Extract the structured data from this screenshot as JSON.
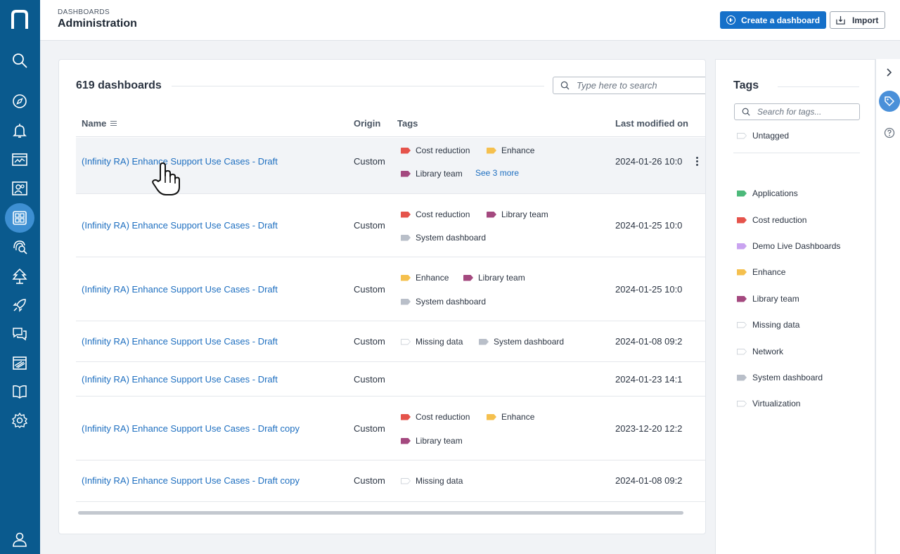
{
  "header": {
    "breadcrumb": "DASHBOARDS",
    "title": "Administration",
    "create_button": "Create a dashboard",
    "import_button": "Import"
  },
  "nav": {
    "items": [
      "logo-icon",
      "search-icon",
      "compass-icon",
      "bell-icon",
      "monitor-chart-icon",
      "user-group-icon",
      "dashboards-icon",
      "fingerprint-search-icon",
      "tree-icon",
      "rocket-icon",
      "chat-icon",
      "report-icon",
      "book-icon",
      "gear-icon",
      "user-icon"
    ],
    "active": "dashboards-icon"
  },
  "list": {
    "count_label": "619 dashboards",
    "search_placeholder": "Type here to search",
    "columns": {
      "name": "Name",
      "origin": "Origin",
      "tags": "Tags",
      "last_modified": "Last modified on"
    },
    "rows": [
      {
        "name": "(Infinity RA) Enhance Support Use Cases - Draft",
        "origin": "Custom",
        "tags": [
          "Cost reduction",
          "Enhance",
          "Library team"
        ],
        "see_more": "See 3 more",
        "date": "2024-01-26 10:0"
      },
      {
        "name": "(Infinity RA) Enhance Support Use Cases - Draft",
        "origin": "Custom",
        "tags": [
          "Cost reduction",
          "Library team",
          "System dashboard"
        ],
        "date": "2024-01-25 10:0"
      },
      {
        "name": "(Infinity RA) Enhance Support Use Cases - Draft",
        "origin": "Custom",
        "tags": [
          "Enhance",
          "Library team",
          "System dashboard"
        ],
        "date": "2024-01-25 10:0"
      },
      {
        "name": "(Infinity RA) Enhance Support Use Cases - Draft",
        "origin": "Custom",
        "tags": [
          "Missing data",
          "System dashboard"
        ],
        "date": "2024-01-08 09:2"
      },
      {
        "name": "(Infinity RA) Enhance Support Use Cases - Draft",
        "origin": "Custom",
        "tags": [],
        "date": "2024-01-23 14:1"
      },
      {
        "name": "(Infinity RA) Enhance Support Use Cases - Draft copy",
        "origin": "Custom",
        "tags": [
          "Cost reduction",
          "Enhance",
          "Library team"
        ],
        "date": "2023-12-20 12:2"
      },
      {
        "name": "(Infinity RA) Enhance Support Use Cases - Draft copy",
        "origin": "Custom",
        "tags": [
          "Missing data"
        ],
        "date": "2024-01-08 09:2"
      }
    ]
  },
  "tag_colors": {
    "Applications": "#4cb97a",
    "Cost reduction": "#e5534b",
    "Demo Live Dashboards": "#c9a3f0",
    "Enhance": "#f5c04e",
    "Library team": "#a4497f",
    "Missing data": "empty",
    "Network": "empty",
    "System dashboard": "#b9bfc9",
    "Virtualization": "empty",
    "Untagged": "empty"
  },
  "tags_panel": {
    "title": "Tags",
    "search_placeholder": "Search for tags...",
    "untagged": "Untagged",
    "items": [
      "Applications",
      "Cost reduction",
      "Demo Live Dashboards",
      "Enhance",
      "Library team",
      "Missing data",
      "Network",
      "System dashboard",
      "Virtualization"
    ]
  }
}
